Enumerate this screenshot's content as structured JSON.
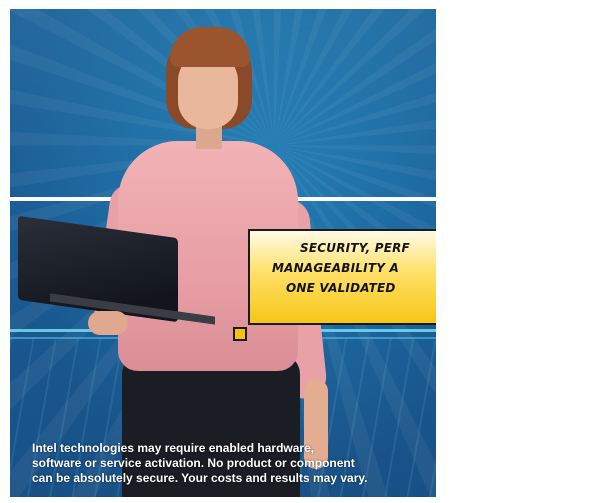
{
  "ad": {
    "callout": {
      "line1": "SECURITY, PERF",
      "line2": "MANAGEABILITY A",
      "line3": "ONE VALIDATED"
    },
    "disclaimer": {
      "line1": "Intel technologies may require enabled hardware,",
      "line2": "software or service activation. No product or component",
      "line3": "can be absolutely secure.  Your costs and results may vary."
    }
  },
  "colors": {
    "background_blue": "#1f6da8",
    "callout_yellow": "#f6c617",
    "sweater_pink": "#e79ea4",
    "page_white": "#ffffff"
  }
}
